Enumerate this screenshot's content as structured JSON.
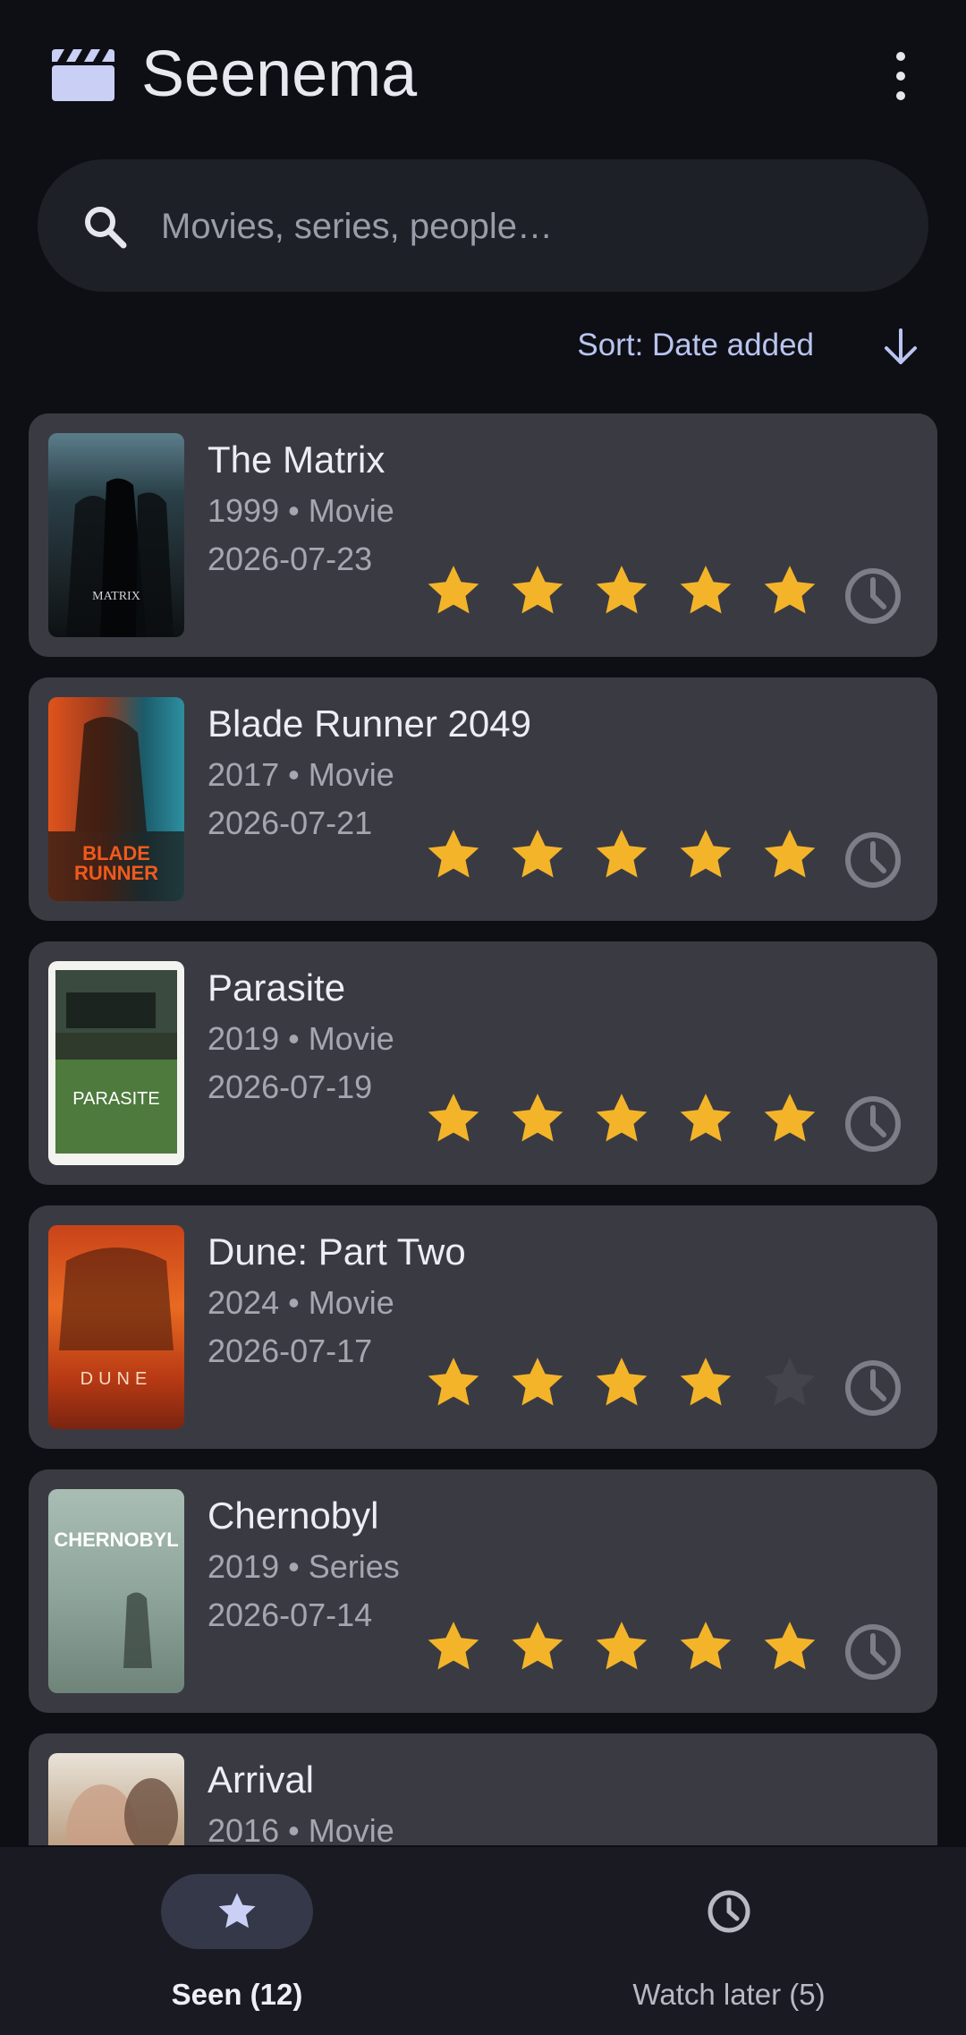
{
  "app": {
    "title": "Seenema",
    "icon": "clapperboard-icon",
    "menu_icon": "more-vert-icon"
  },
  "search": {
    "placeholder": "Movies, series, people…",
    "value": ""
  },
  "sort": {
    "label": "Sort: Date added",
    "direction_icon": "arrow-down-icon"
  },
  "colors": {
    "background": "#0e0f14",
    "card": "#3a3b42",
    "star_filled": "#f4b42a",
    "star_empty": "#44454c",
    "accent": "#b9c4f0"
  },
  "items": [
    {
      "title": "The Matrix",
      "meta": "1999 • Movie",
      "date": "2026-07-23",
      "rating": 5
    },
    {
      "title": "Blade Runner 2049",
      "meta": "2017 • Movie",
      "date": "2026-07-21",
      "rating": 5
    },
    {
      "title": "Parasite",
      "meta": "2019 • Movie",
      "date": "2026-07-19",
      "rating": 5
    },
    {
      "title": "Dune: Part Two",
      "meta": "2024 • Movie",
      "date": "2026-07-17",
      "rating": 4
    },
    {
      "title": "Chernobyl",
      "meta": "2019 • Series",
      "date": "2026-07-14",
      "rating": 5
    },
    {
      "title": "Arrival",
      "meta": "2016 • Movie",
      "date": "",
      "rating": null
    }
  ],
  "nav": {
    "seen": {
      "label": "Seen (12)",
      "icon": "star-icon",
      "selected": true
    },
    "watch_later": {
      "label": "Watch later (5)",
      "icon": "clock-icon",
      "selected": false
    }
  }
}
